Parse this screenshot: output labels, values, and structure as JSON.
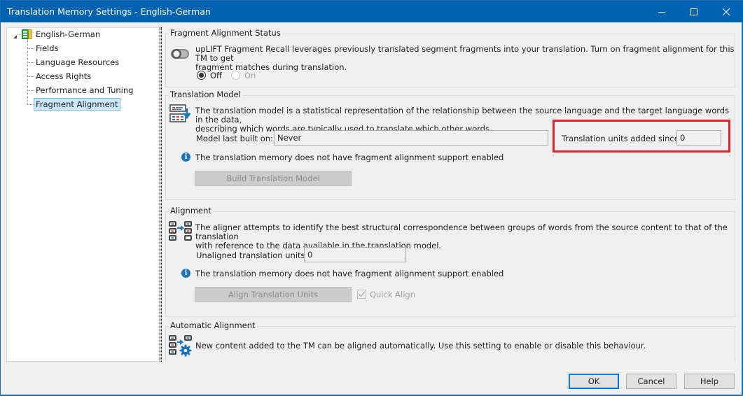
{
  "window": {
    "title": "Translation Memory Settings - English-German",
    "controls": [
      "minimize-icon",
      "maximize-icon",
      "close-icon"
    ]
  },
  "tree": {
    "root": {
      "label": "English-German",
      "icon": "translation-memory-icon",
      "expanded": true
    },
    "children": [
      {
        "label": "Fields"
      },
      {
        "label": "Language Resources"
      },
      {
        "label": "Access Rights"
      },
      {
        "label": "Performance and Tuning"
      },
      {
        "label": "Fragment Alignment",
        "selected": true
      }
    ]
  },
  "fragment_status": {
    "title": "Fragment Alignment Status",
    "description_line1": "upLIFT Fragment Recall leverages previously translated segment fragments into your translation. Turn on fragment alignment for this TM to get",
    "description_line2": "fragment matches during translation.",
    "toggle_state": "off",
    "radio_off_label": "Off",
    "radio_on_label": "On",
    "selected": "Off"
  },
  "translation_model": {
    "title": "Translation Model",
    "description_line1": "The translation model is a statistical representation of the relationship between the source language and the target language words in the data,",
    "description_line2": "describing which words are typically used to translate which other words.",
    "last_built_label": "Model last built on:",
    "last_built_value": "Never",
    "units_added_label": "Translation units added since:",
    "units_added_value": "0",
    "info_message": "The translation memory does not have fragment alignment support enabled",
    "build_button_label": "Build Translation Model",
    "highlight_color": "#e8212b"
  },
  "alignment": {
    "title": "Alignment",
    "description_line1": "The aligner attempts to identify the best structural correspondence between groups of words from the source content to that of the translation",
    "description_line2": "with reference to the data available in the translation model.",
    "unaligned_label": "Unaligned translation units:",
    "unaligned_value": "0",
    "info_message": "The translation memory does not have fragment alignment support enabled",
    "align_button_label": "Align Translation Units",
    "quick_align_label": "Quick Align",
    "quick_align_checked": true
  },
  "automatic_alignment": {
    "title": "Automatic Alignment",
    "description": "New content added to the TM can be aligned automatically. Use this setting to enable or disable this behaviour."
  },
  "buttons": {
    "ok": "OK",
    "cancel": "Cancel",
    "help": "Help"
  },
  "colors": {
    "titlebar": "#0063b1",
    "accent": "#0078d7",
    "selection": "#cce8ff"
  }
}
